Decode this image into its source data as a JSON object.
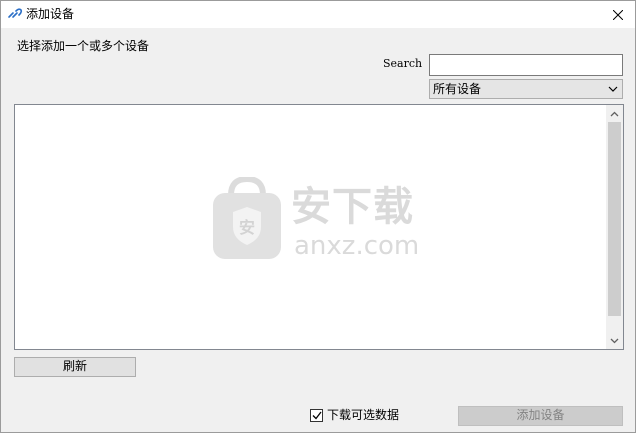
{
  "window": {
    "title": "添加设备",
    "close_glyph": "×"
  },
  "instruction": "选择添加一个或多个设备",
  "search": {
    "label": "Search",
    "value": "",
    "placeholder": ""
  },
  "filter": {
    "selected": "所有设备"
  },
  "watermark": {
    "chinese": "安下载",
    "domain": "anxz.com",
    "badge_char": "安"
  },
  "buttons": {
    "refresh": "刷新",
    "add_device": "添加设备"
  },
  "download_option": {
    "label": "下载可选数据",
    "checked": true
  },
  "icons": {
    "app": "link-icon",
    "close": "close-icon",
    "dropdown": "chevron-down-icon",
    "scroll_up": "scroll-up-arrow-icon",
    "scroll_down": "scroll-down-arrow-icon",
    "check": "checkmark-icon"
  }
}
